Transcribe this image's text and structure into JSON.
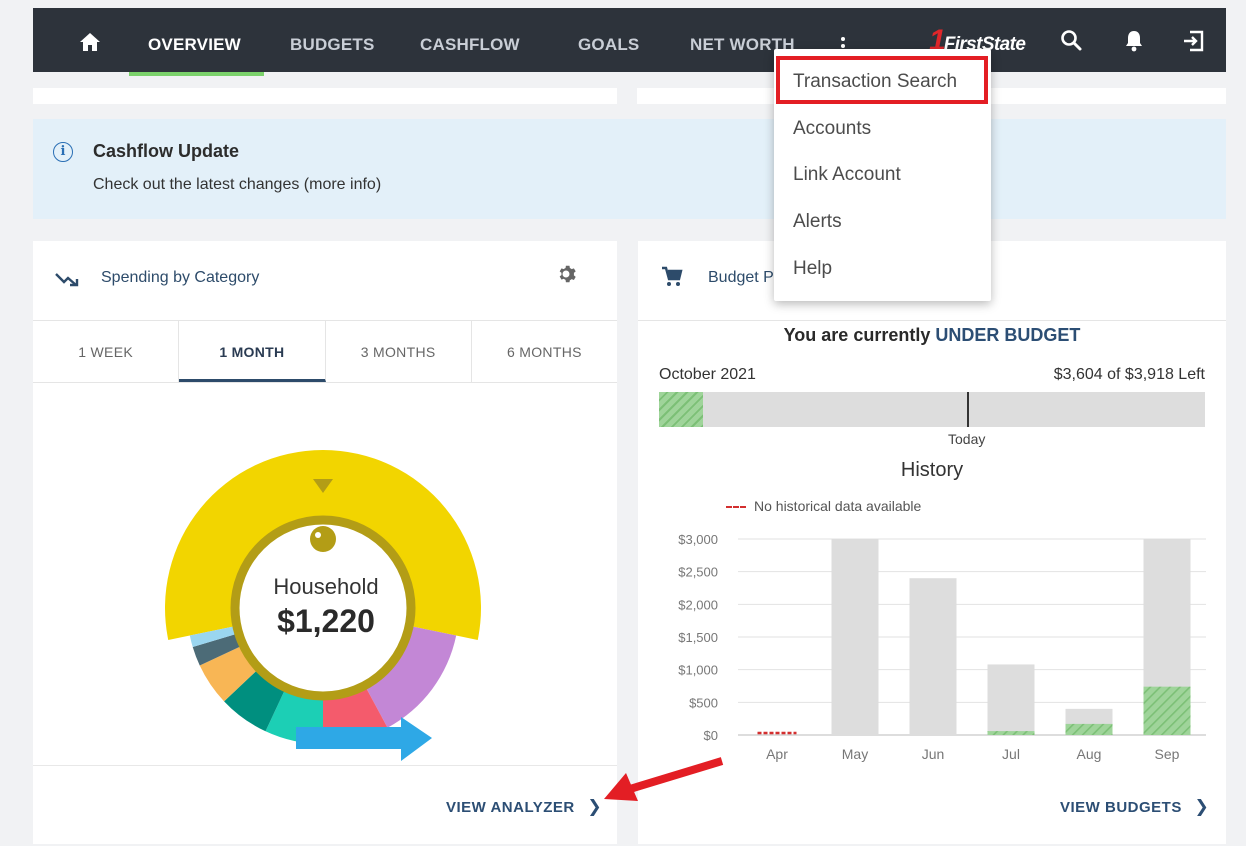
{
  "nav": {
    "items": [
      "OVERVIEW",
      "BUDGETS",
      "CASHFLOW",
      "GOALS",
      "NET WORTH"
    ],
    "active": "OVERVIEW",
    "brand_one": "1",
    "brand_text": "FirstState"
  },
  "dropdown": {
    "items": [
      "Transaction Search",
      "Accounts",
      "Link Account",
      "Alerts",
      "Help"
    ],
    "highlighted": "Transaction Search",
    "highlight_color": "#e31e24"
  },
  "banner": {
    "title": "Cashflow Update",
    "text": "Check out the latest changes (more info)",
    "info_glyph": "i"
  },
  "spending": {
    "title": "Spending by Category",
    "tabs": [
      "1 WEEK",
      "1 MONTH",
      "3 MONTHS",
      "6 MONTHS"
    ],
    "active_tab": "1 MONTH",
    "center_label": "Household",
    "center_value": "$1,220",
    "link": "VIEW ANALYZER",
    "slices": [
      {
        "color": "#f2d500",
        "value": 1220,
        "name": "Household"
      },
      {
        "color": "#c387d6",
        "value": 300
      },
      {
        "color": "#f45b6c",
        "value": 170
      },
      {
        "color": "#1ccfb5",
        "value": 150
      },
      {
        "color": "#008f7f",
        "value": 130
      },
      {
        "color": "#f8b655",
        "value": 110
      },
      {
        "color": "#4c6b77",
        "value": 50
      },
      {
        "color": "#9ad6f0",
        "value": 30
      }
    ]
  },
  "budget": {
    "title": "Budget P",
    "headline_prefix": "You are currently ",
    "headline_status": "UNDER BUDGET",
    "month": "October 2021",
    "summary": "$3,604 of $3,918 Left",
    "progress_fraction": 0.08,
    "today_fraction": 0.565,
    "today_label": "Today",
    "history_title": "History",
    "legend": "No historical data available",
    "link": "VIEW BUDGETS"
  },
  "chart_data": {
    "type": "bar",
    "categories": [
      "Apr",
      "May",
      "Jun",
      "Jul",
      "Aug",
      "Sep"
    ],
    "series": [
      {
        "values": [
          0,
          3000,
          2400,
          1080,
          400,
          3000
        ]
      },
      {
        "values": [
          0,
          0,
          0,
          60,
          170,
          740
        ]
      }
    ],
    "yticks": [
      "$3,000",
      "$2,500",
      "$2,000",
      "$1,500",
      "$1,000",
      "$500",
      "$0"
    ],
    "ylim": [
      0,
      3000
    ],
    "grid": true,
    "colors": {
      "budget": "#dddddd",
      "spent": "#9fd49a",
      "no_data": "#d32f2f"
    }
  }
}
